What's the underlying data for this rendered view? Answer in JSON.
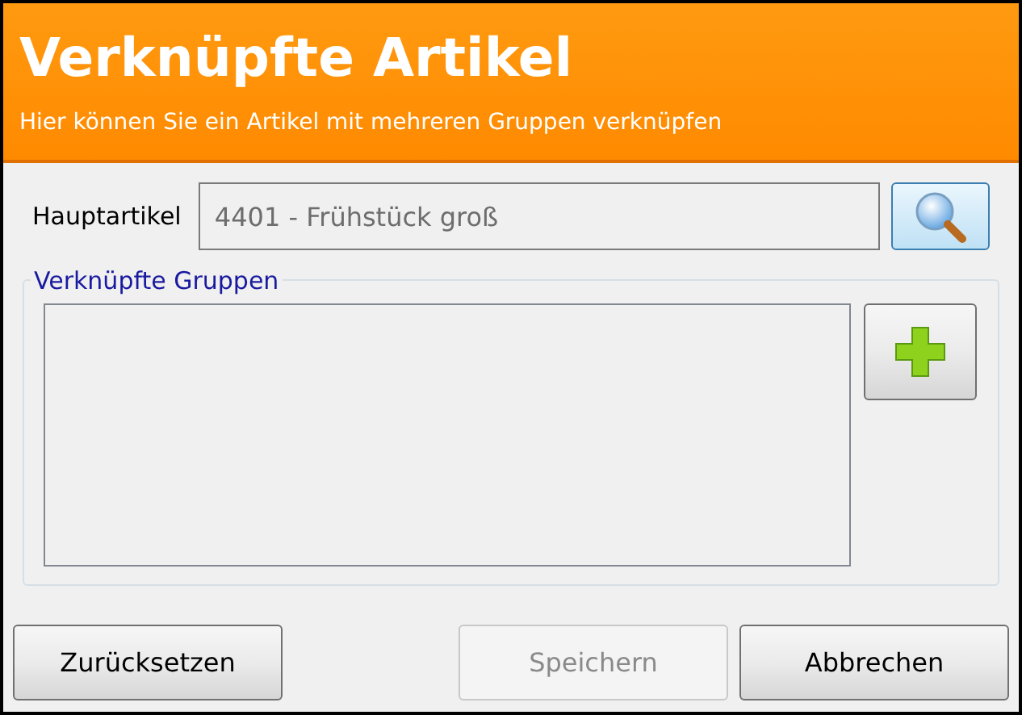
{
  "header": {
    "title": "Verknüpfte Artikel",
    "subtitle": "Hier können Sie ein Artikel mit mehreren Gruppen verknüpfen"
  },
  "main_article": {
    "label": "Hauptartikel",
    "value": "4401 - Frühstück groß"
  },
  "linked_groups": {
    "title": "Verknüpfte Gruppen"
  },
  "buttons": [
    {
      "label": "Zurücksetzen",
      "disabled": false
    },
    {
      "label": "Speichern",
      "disabled": true
    },
    {
      "label": "Abbrechen",
      "disabled": false
    }
  ]
}
